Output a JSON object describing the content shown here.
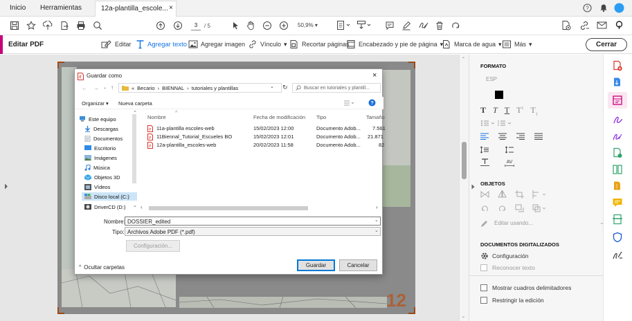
{
  "tabs": {
    "home": "Inicio",
    "tools": "Herramientas",
    "document": "12a-plantilla_escole...",
    "close": "×"
  },
  "toolbar": {
    "page_current": "3",
    "page_total": "/ 5",
    "zoom": "50,9%"
  },
  "edit_toolbar": {
    "title": "Editar PDF",
    "edit": "Editar",
    "add_text": "Agregar texto",
    "add_image": "Agregar imagen",
    "link": "Vínculo",
    "crop": "Recortar páginas",
    "header_footer": "Encabezado y pie de página",
    "watermark": "Marca de agua",
    "more": "Más",
    "close": "Cerrar"
  },
  "dialog": {
    "title": "Guardar como",
    "close": "×",
    "breadcrumb": [
      "Becario",
      "BIENNAL",
      "tutoriales y plantillas"
    ],
    "search_placeholder": "Buscar en tutoriales y plantill...",
    "organize": "Organizar ▾",
    "new_folder": "Nueva carpeta",
    "nav_items": [
      {
        "label": "Este equipo"
      },
      {
        "label": "Descargas"
      },
      {
        "label": "Documentos"
      },
      {
        "label": "Escritorio"
      },
      {
        "label": "Imágenes"
      },
      {
        "label": "Música"
      },
      {
        "label": "Objetos 3D"
      },
      {
        "label": "Vídeos"
      },
      {
        "label": "Disco local (C:)"
      },
      {
        "label": "DriverCD (D:)"
      }
    ],
    "columns": {
      "name": "Nombre",
      "modified": "Fecha de modificación",
      "type": "Tipo",
      "size": "Tamaño"
    },
    "files": [
      {
        "name": "11a-plantilla escoles-web",
        "modified": "15/02/2023 12:00",
        "type": "Documento Adob...",
        "size": "7.561"
      },
      {
        "name": "11Biennal_Tutorial_Escueles BO",
        "modified": "15/02/2023 12:01",
        "type": "Documento Adob...",
        "size": "21.871"
      },
      {
        "name": "12a-plantilla_escoles-web",
        "modified": "20/02/2023 11:58",
        "type": "Documento Adob...",
        "size": "82"
      }
    ],
    "filename_label": "Nombre:",
    "filename_value": "DOSSIER_edited",
    "type_label": "Tipo:",
    "type_value": "Archivos Adobe PDF (*.pdf)",
    "settings": "Configuración...",
    "hide_folders": "Ocultar carpetas",
    "save": "Guardar",
    "cancel": "Cancelar"
  },
  "right_panel": {
    "format_title": "FORMATO",
    "font_name": "ESP",
    "objects_title": "OBJETOS",
    "edit_using": "Editar usando...",
    "scanned_title": "DOCUMENTOS DIGITALIZADOS",
    "settings": "Configuración",
    "recognize": "Reconocer texto",
    "show_boxes": "Mostrar cuadros delimitadores",
    "restrict": "Restringir la edición"
  },
  "page_number_overlay": "12",
  "colors": {
    "accent": "#c8007a",
    "blue": "#1473e6",
    "pdf_red": "#d9342b",
    "folder": "#e8b93c"
  }
}
